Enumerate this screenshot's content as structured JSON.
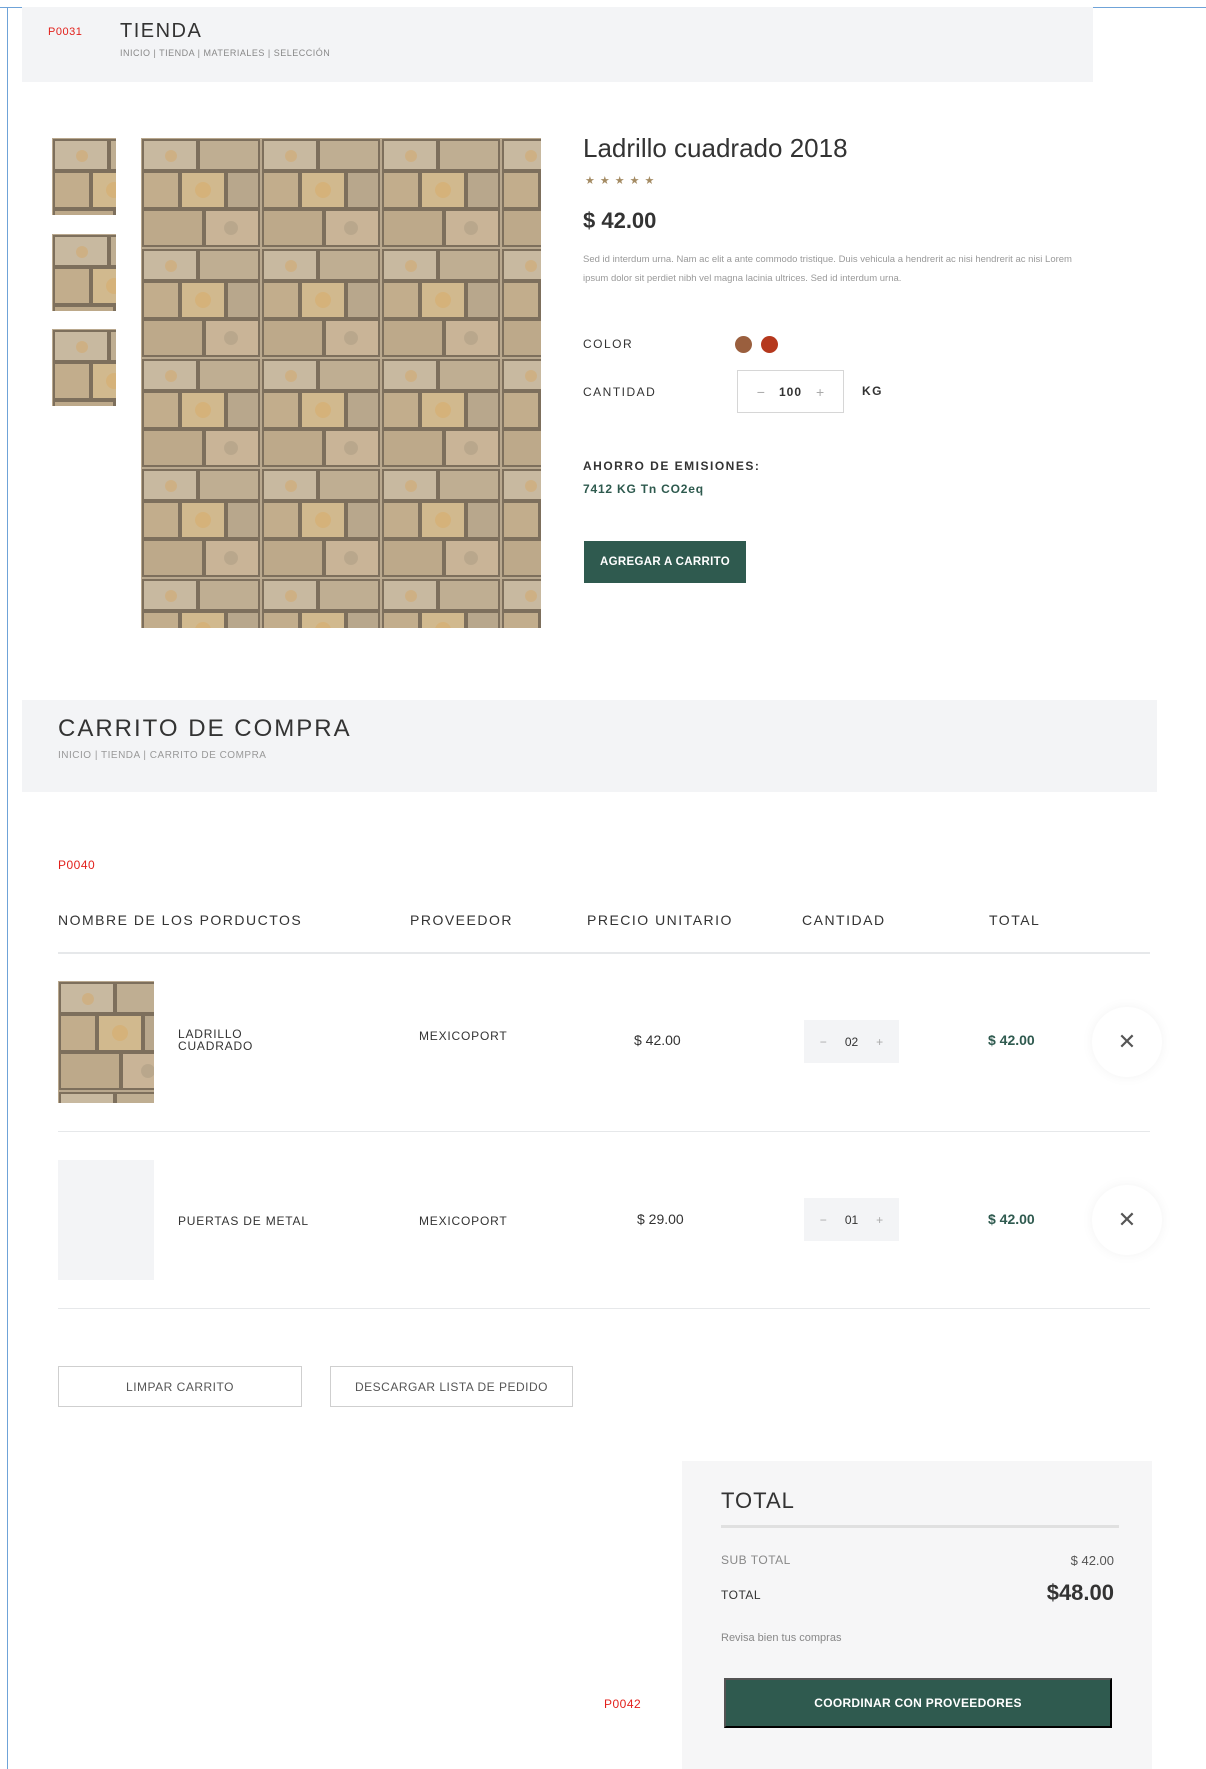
{
  "codes": {
    "top": "P0031",
    "cart": "P0040",
    "bottom": "P0042"
  },
  "store_header": {
    "title": "TIENDA",
    "breadcrumb": "INICIO | TIENDA | MATERIALES | SELECCIÓN"
  },
  "product": {
    "title": "Ladrillo cuadrado 2018",
    "rating": 5,
    "stars": "★★★★★",
    "price": "$ 42.00",
    "description": "Sed id interdum urna. Nam ac elit a ante commodo tristique. Duis vehicula a hendrerit ac nisi hendrerit ac nisi Lorem ipsum dolor sit perdiet nibh vel magna lacinia ultrices. Sed id interdum urna.",
    "color_label": "COLOR",
    "colors": [
      "#9a5f3e",
      "#b5381d"
    ],
    "quantity_label": "CANTIDAD",
    "quantity_minus": "−",
    "quantity_value": "100",
    "quantity_plus": "+",
    "quantity_unit": "KG",
    "emissions_label": "AHORRO DE EMISIONES:",
    "emissions_value": "7412 KG Tn CO2eq",
    "add_button": "AGREGAR A CARRITO"
  },
  "cart_header": {
    "title": "CARRITO DE COMPRA",
    "breadcrumb": "INICIO | TIENDA | CARRITO DE COMPRA"
  },
  "cart_table": {
    "headers": [
      "NOMBRE DE LOS PORDUCTOS",
      "PROVEEDOR",
      "PRECIO UNITARIO",
      "CANTIDAD",
      "TOTAL"
    ],
    "rows": [
      {
        "name_line1": "LADRILLO",
        "name_line2": "CUADRADO",
        "supplier": "MEXICOPORT",
        "unit_price": "$ 42.00",
        "qty": "02",
        "total": "$ 42.00",
        "minus": "−",
        "plus": "+",
        "remove": "✕"
      },
      {
        "name_line1": "PUERTAS DE METAL",
        "name_line2": "",
        "supplier": "MEXICOPORT",
        "unit_price": "$ 29.00",
        "qty": "01",
        "total": "$ 42.00",
        "minus": "−",
        "plus": "+",
        "remove": "✕"
      }
    ]
  },
  "actions": {
    "clear": "LIMPAR CARRITO",
    "download": "DESCARGAR LISTA DE PEDIDO"
  },
  "summary": {
    "title": "TOTAL",
    "subtotal_label": "SUB TOTAL",
    "subtotal_value": "$ 42.00",
    "total_label": "TOTAL",
    "total_value": "$48.00",
    "note": "Revisa bien tus compras",
    "button": "COORDINAR CON PROVEEDORES"
  }
}
